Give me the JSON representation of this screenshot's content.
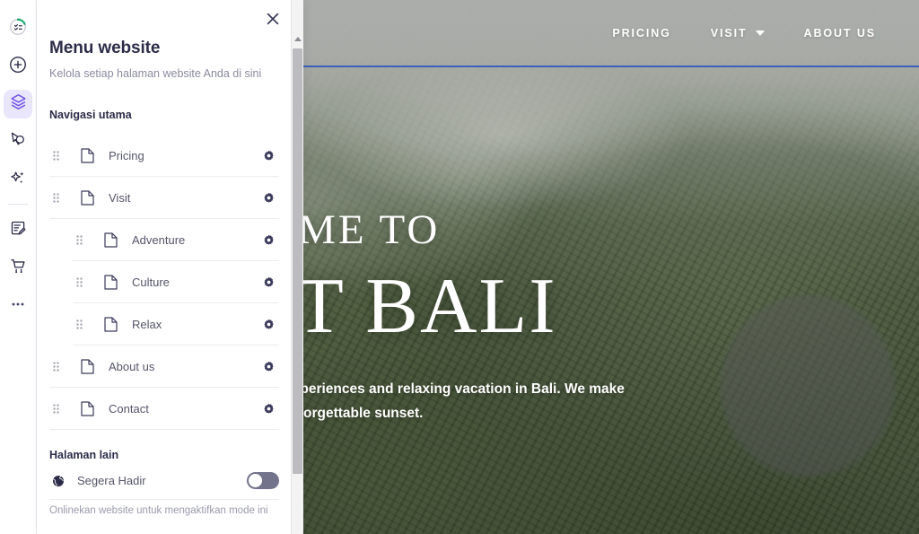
{
  "rail": {
    "items": [
      {
        "name": "progress-checklist-icon",
        "label": "Progress"
      },
      {
        "name": "add-circle-icon",
        "label": "Tambah"
      },
      {
        "name": "layers-icon",
        "label": "Halaman",
        "active": true
      },
      {
        "name": "cursor-chat-icon",
        "label": "Interaksi"
      },
      {
        "name": "sparkle-ai-icon",
        "label": "AI"
      },
      {
        "name": "form-edit-icon",
        "label": "Formulir"
      },
      {
        "name": "shopping-cart-icon",
        "label": "Toko"
      },
      {
        "name": "more-options-icon",
        "label": "Lainnya"
      }
    ]
  },
  "panel": {
    "title": "Menu website",
    "subtitle": "Kelola setiap halaman website Anda di sini",
    "close_label": "Tutup",
    "nav_section_label": "Navigasi utama",
    "menu_items": [
      {
        "label": "Pricing",
        "child": false
      },
      {
        "label": "Visit",
        "child": false
      },
      {
        "label": "Adventure",
        "child": true
      },
      {
        "label": "Culture",
        "child": true
      },
      {
        "label": "Relax",
        "child": true
      },
      {
        "label": "About us",
        "child": false
      },
      {
        "label": "Contact",
        "child": false
      }
    ],
    "other_section_label": "Halaman lain",
    "coming_soon_label": "Segera Hadir",
    "coming_soon_enabled": false,
    "hint": "Onlinekan website untuk mengaktifkan mode ini"
  },
  "preview": {
    "nav": [
      {
        "label": "PRICING",
        "has_caret": false
      },
      {
        "label": "VISIT",
        "has_caret": true
      },
      {
        "label": "ABOUT US",
        "has_caret": false
      }
    ],
    "hero_line1": "WELCOME TO",
    "hero_line2": "VISIT BALI",
    "hero_paragraph": "Get ready for mystical experiences and relaxing vacation in Bali. We make sure that you'll get an unforgettable sunset."
  },
  "colors": {
    "accent_purple": "#6b4de6",
    "section_rule_blue": "#3b5fbe",
    "text_dark": "#2c2c4a",
    "text_muted": "#8a8aa0",
    "toggle_off": "#73738c"
  }
}
